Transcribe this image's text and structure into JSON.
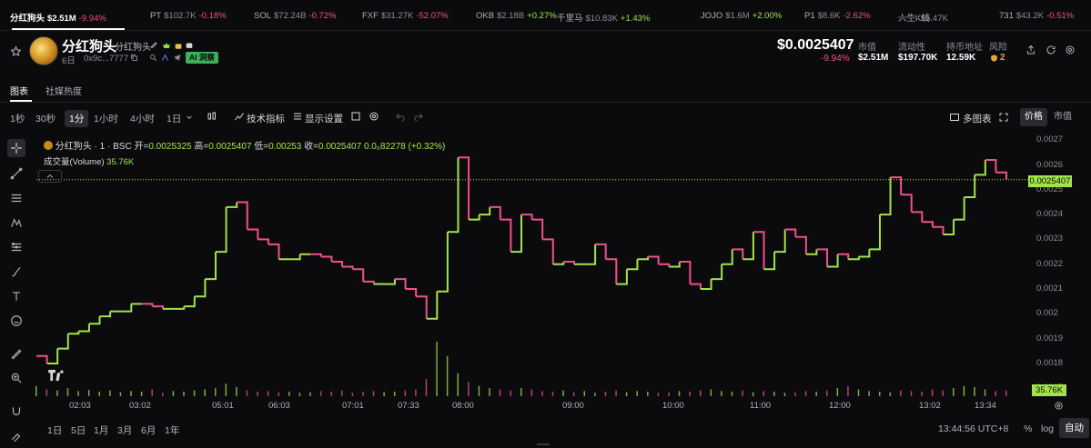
{
  "ticker": [
    {
      "symbol": "分红狗头",
      "price": "$2.51M",
      "change": "-9.94%",
      "dir": "down"
    },
    {
      "symbol": "PT",
      "price": "$102.7K",
      "change": "-0.18%",
      "dir": "down"
    },
    {
      "symbol": "SOL",
      "price": "$72.24B",
      "change": "-0.72%",
      "dir": "down"
    },
    {
      "symbol": "FXF",
      "price": "$31.27K",
      "change": "-52.07%",
      "dir": "down"
    },
    {
      "symbol": "OKB",
      "price": "$2.18B",
      "change": "+0.27%",
      "dir": "up"
    },
    {
      "symbol": "千里马",
      "price": "$10.83K",
      "change": "+1.43%",
      "dir": "up"
    },
    {
      "symbol": "JOJO",
      "price": "$1.6M",
      "change": "+2.00%",
      "dir": "up"
    },
    {
      "symbol": "P1",
      "price": "$8.6K",
      "change": "-2.62%",
      "dir": "down"
    },
    {
      "symbol": "人生K线",
      "price": "$5.47K",
      "change": "",
      "dir": "down"
    },
    {
      "symbol": "731",
      "price": "$43.2K",
      "change": "-0.51%",
      "dir": "down"
    }
  ],
  "token": {
    "name": "分红狗头",
    "subname": "分红狗头",
    "age": "6日",
    "address": "0x9c...7777",
    "ai_badge": "AI 洞察"
  },
  "price": {
    "value": "$0.0025407",
    "change": "-9.94%"
  },
  "stats": [
    {
      "label": "市值",
      "value": "$2.51M"
    },
    {
      "label": "流动性",
      "value": "$197.70K"
    },
    {
      "label": "持币地址",
      "value": "12.59K"
    },
    {
      "label": "风险",
      "value": "2"
    }
  ],
  "tabs": [
    {
      "label": "图表",
      "active": true
    },
    {
      "label": "社媒热度",
      "active": false
    }
  ],
  "timeframes": [
    {
      "label": "1秒",
      "active": false
    },
    {
      "label": "30秒",
      "active": false
    },
    {
      "label": "1分",
      "active": true
    },
    {
      "label": "1小时",
      "active": false
    },
    {
      "label": "4小时",
      "active": false
    },
    {
      "label": "1日",
      "active": false
    }
  ],
  "toolbar": {
    "indicators": "技术指标",
    "display_settings": "显示设置",
    "multi_chart": "多图表",
    "price_toggle": "价格",
    "mcap_toggle": "市值"
  },
  "legend": {
    "symbol": "分红狗头 · 1 · BSC",
    "open_label": "开=",
    "open": "0.0025325",
    "high_label": "高=",
    "high": "0.0025407",
    "low_label": "低=",
    "low": "0.00253",
    "close_label": "收=",
    "close": "0.0025407",
    "change": "0.0₆82278 (+0.32%)",
    "volume_label": "成交量(Volume)",
    "volume": "35.76K"
  },
  "y_axis": {
    "ticks": [
      "0.0027",
      "0.0026",
      "0.0025",
      "0.0024",
      "0.0023",
      "0.0022",
      "0.0021",
      "0.002",
      "0.0019",
      "0.0018",
      "0.0017"
    ],
    "last_price": "0.0025407",
    "last_volume": "35.76K"
  },
  "x_axis": {
    "ticks": [
      "02:03",
      "03:02",
      "05:01",
      "06:03",
      "07:01",
      "07:33",
      "08:00",
      "09:00",
      "10:00",
      "11:00",
      "12:00",
      "13:02",
      "13:34"
    ]
  },
  "ranges": [
    "1日",
    "5日",
    "1月",
    "3月",
    "6月",
    "1年"
  ],
  "footer": {
    "clock": "13:44:56 UTC+8",
    "percent": "%",
    "log": "log",
    "auto": "自动"
  },
  "colors": {
    "up": "#a2e34a",
    "down": "#f0508a",
    "background": "#0b0b0d"
  },
  "chart_data": {
    "type": "line",
    "series": [
      {
        "values": [
          0.00183,
          0.0018,
          0.00186,
          0.00192,
          0.00193,
          0.00196,
          0.00199,
          0.00201,
          0.00201,
          0.00204,
          0.00204,
          0.00203,
          0.00202,
          0.00202,
          0.00203,
          0.00207,
          0.00214,
          0.00225,
          0.00243,
          0.00245,
          0.00234,
          0.0023,
          0.00228,
          0.00222,
          0.00222,
          0.00224,
          0.00224,
          0.00223,
          0.00221,
          0.00219,
          0.00218,
          0.00213,
          0.00212,
          0.00212,
          0.00214,
          0.0021,
          0.00207,
          0.00198,
          0.00209,
          0.00233,
          0.00263,
          0.00238,
          0.0024,
          0.00243,
          0.00238,
          0.00225,
          0.0024,
          0.00238,
          0.0023,
          0.0022,
          0.00221,
          0.0022,
          0.0022,
          0.00228,
          0.00222,
          0.00212,
          0.00218,
          0.00222,
          0.00223,
          0.0022,
          0.00219,
          0.00221,
          0.00212,
          0.0021,
          0.00214,
          0.0022,
          0.00226,
          0.00222,
          0.00233,
          0.00218,
          0.00225,
          0.00234,
          0.00231,
          0.00224,
          0.00226,
          0.00219,
          0.00224,
          0.00222,
          0.00223,
          0.00226,
          0.0024,
          0.00255,
          0.00248,
          0.00241,
          0.00237,
          0.00235,
          0.00232,
          0.00238,
          0.00247,
          0.00256,
          0.00262,
          0.00257,
          0.00254
        ]
      }
    ],
    "volume_values": [
      18,
      12,
      10,
      14,
      9,
      11,
      8,
      10,
      7,
      9,
      8,
      12,
      6,
      9,
      8,
      10,
      12,
      14,
      22,
      16,
      10,
      8,
      9,
      7,
      8,
      6,
      7,
      9,
      8,
      10,
      6,
      8,
      9,
      7,
      8,
      10,
      12,
      30,
      95,
      70,
      40,
      25,
      18,
      14,
      12,
      10,
      14,
      12,
      9,
      8,
      10,
      7,
      9,
      6,
      8,
      10,
      7,
      9,
      8,
      6,
      7,
      9,
      8,
      10,
      12,
      9,
      8,
      10,
      7,
      9,
      8,
      6,
      7,
      9,
      8,
      10,
      14,
      18,
      12,
      9,
      8,
      7,
      10,
      9,
      8,
      12,
      10,
      14,
      18,
      16,
      12,
      9,
      10
    ],
    "ylim": [
      0.00169,
      0.00273
    ],
    "y_ticks": [
      0.0027,
      0.0026,
      0.0025,
      0.0024,
      0.0023,
      0.0022,
      0.0021,
      0.002,
      0.0019,
      0.0018,
      0.0017
    ],
    "x_tick_labels": [
      "02:03",
      "03:02",
      "05:01",
      "06:03",
      "07:01",
      "07:33",
      "08:00",
      "09:00",
      "10:00",
      "11:00",
      "12:00",
      "13:02",
      "13:34"
    ],
    "grid": false,
    "last_price_line": 0.0025407
  }
}
